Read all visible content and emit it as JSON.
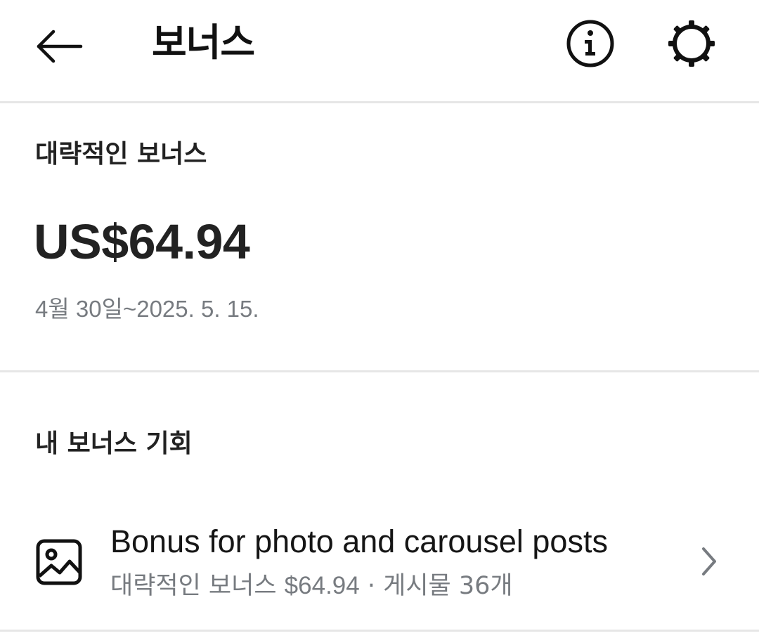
{
  "header": {
    "back_icon": "arrow-left-icon",
    "title": "보너스",
    "info_icon": "info-circle-icon",
    "settings_icon": "gear-icon"
  },
  "summary": {
    "label": "대략적인 보너스",
    "amount": "US$64.94",
    "period": "4월 30일~2025. 5. 15."
  },
  "opportunities": {
    "section_title": "내 보너스 기회",
    "items": [
      {
        "icon": "image-icon",
        "title": "Bonus for photo and carousel posts",
        "subtitle_label": "대략적인 보너스",
        "subtitle_amount": "$64.94",
        "subtitle_separator": "·",
        "subtitle_posts": "게시물 36개",
        "chevron_icon": "chevron-right-icon"
      }
    ]
  },
  "colors": {
    "text_primary": "#111111",
    "text_secondary": "#777b80",
    "divider": "#e6e6e6",
    "background": "#ffffff"
  }
}
